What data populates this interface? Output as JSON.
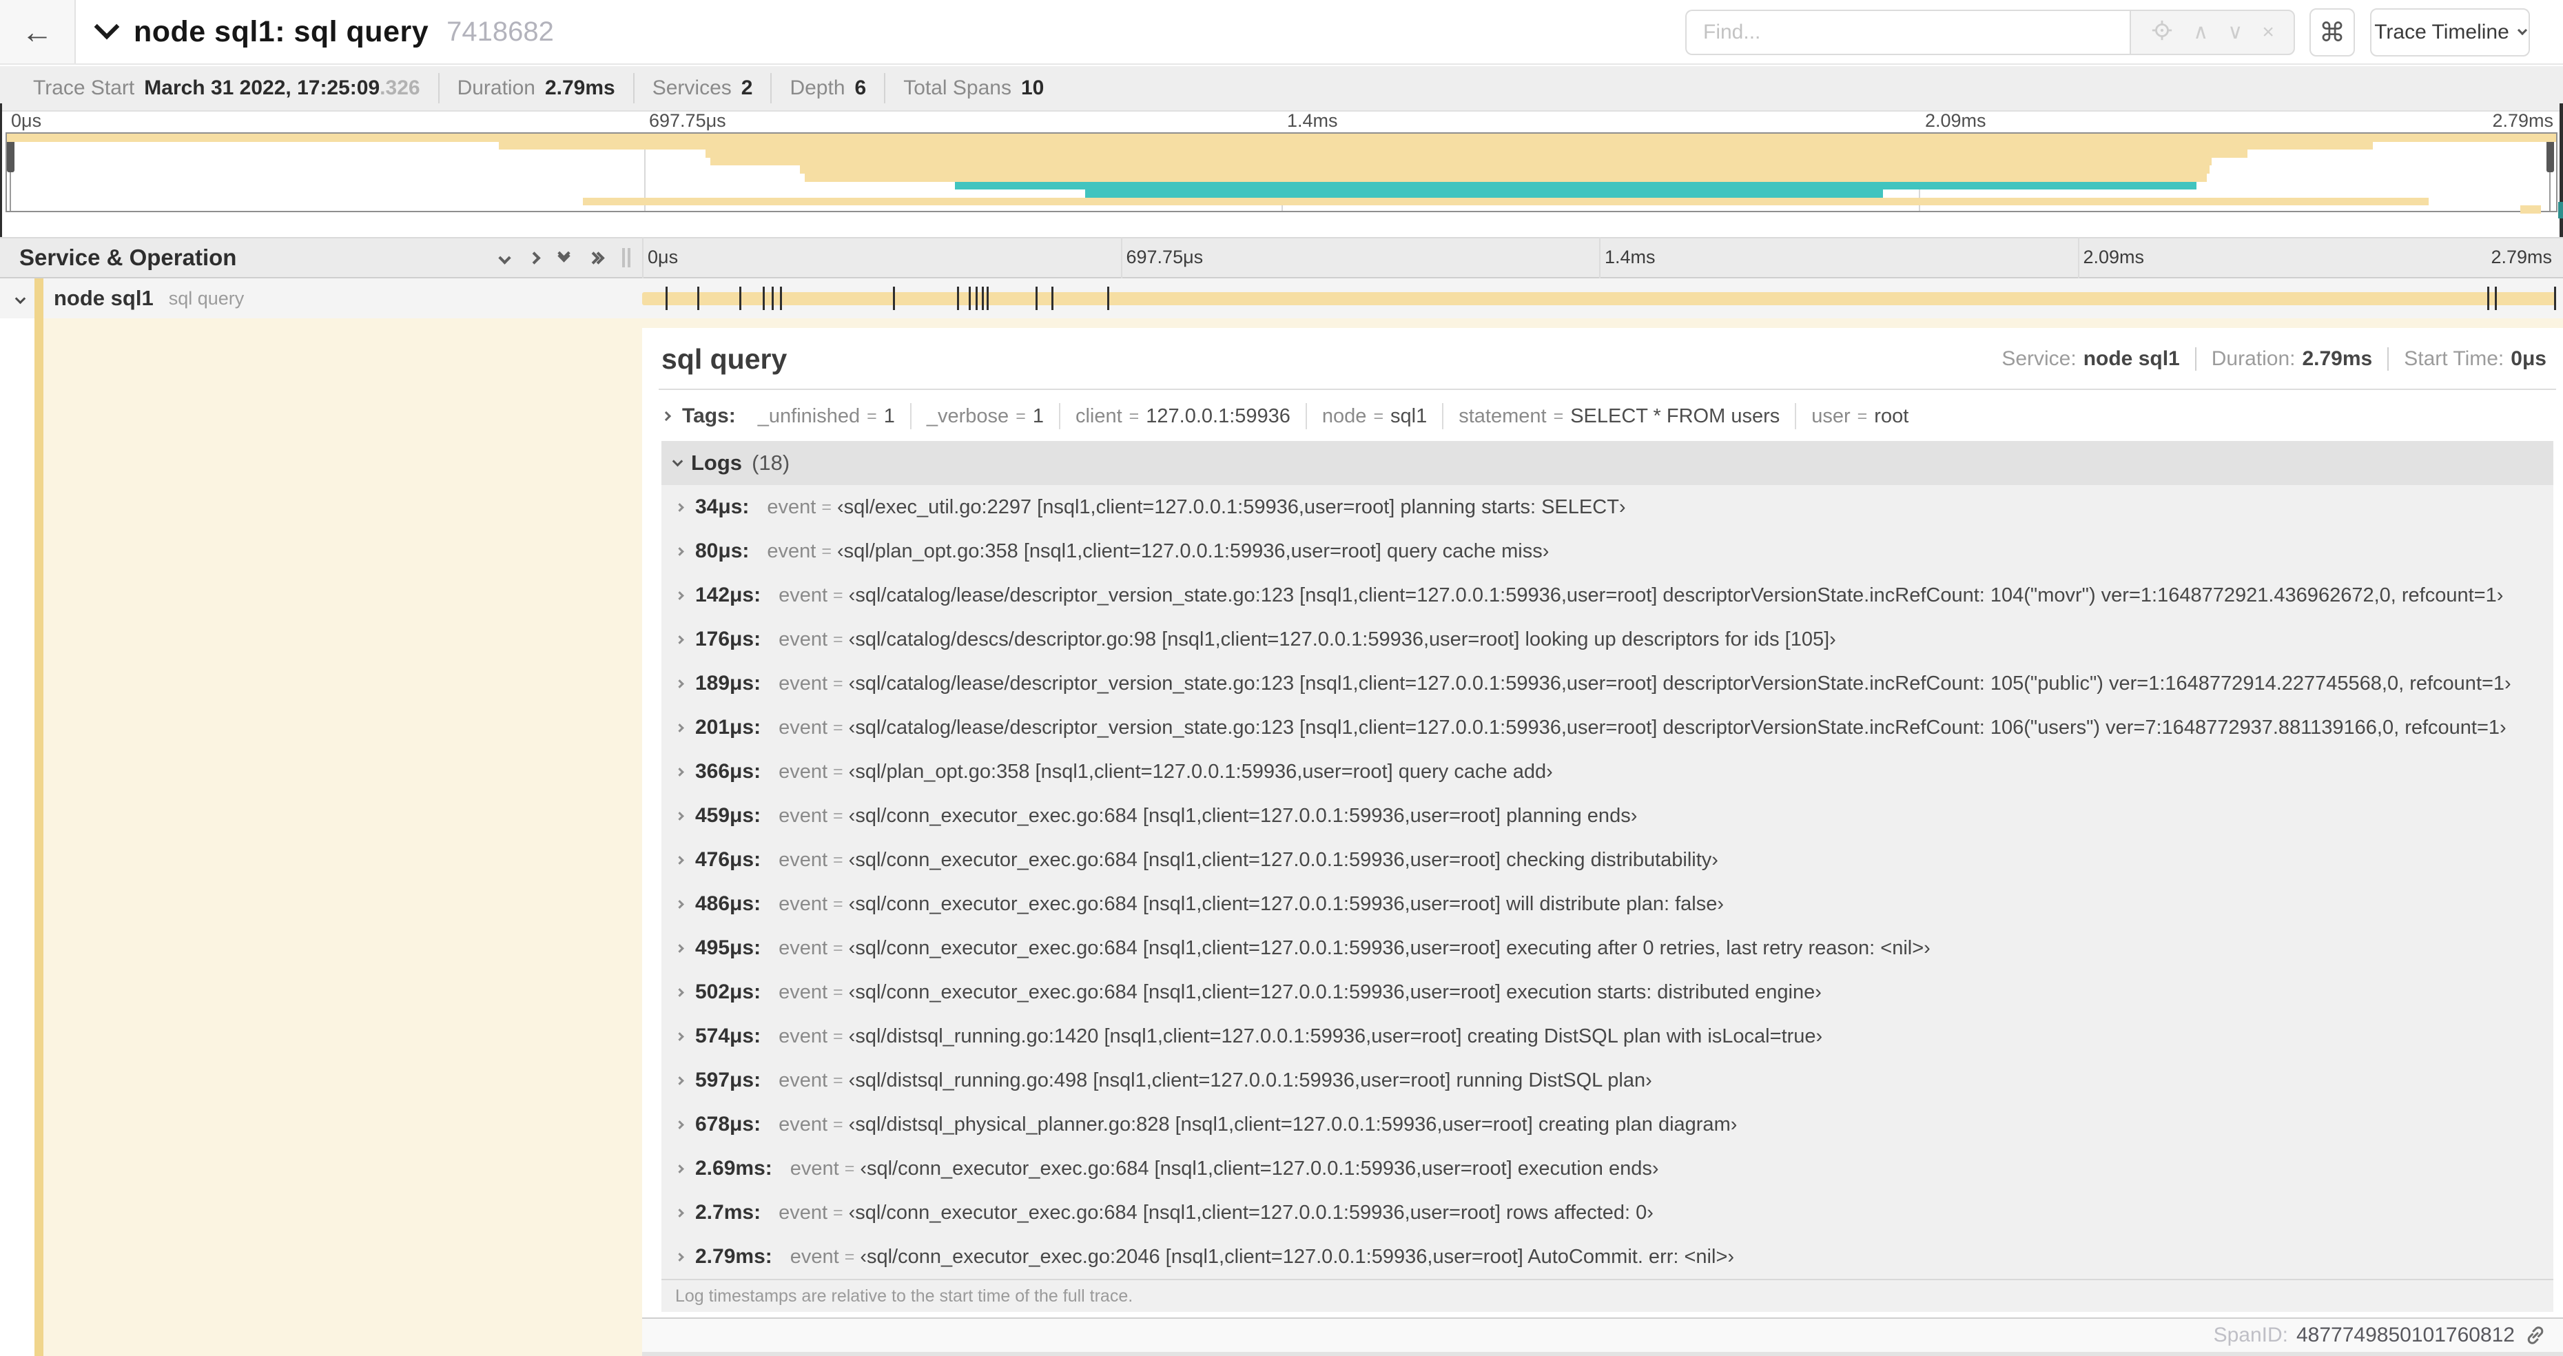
{
  "app": {
    "title": "node sql1: sql query",
    "trace_id": "7418682"
  },
  "icons": {
    "back": "←",
    "command": "⌘",
    "find_prev": "∧",
    "find_next": "∨",
    "find_clear": "×"
  },
  "header": {
    "find_placeholder": "Find...",
    "view_selector_label": "Trace Timeline"
  },
  "summary": {
    "items": [
      {
        "label": "Trace Start",
        "value": "March 31 2022, 17:25:09",
        "suffix": ".326"
      },
      {
        "label": "Duration",
        "value": "2.79ms",
        "suffix": ""
      },
      {
        "label": "Services",
        "value": "2",
        "suffix": ""
      },
      {
        "label": "Depth",
        "value": "6",
        "suffix": ""
      },
      {
        "label": "Total Spans",
        "value": "10",
        "suffix": ""
      }
    ]
  },
  "timeline": {
    "left_header": "Service & Operation",
    "ruler_labels": [
      {
        "label": "0μs",
        "pct": 0
      },
      {
        "label": "697.75μs",
        "pct": 25
      },
      {
        "label": "1.4ms",
        "pct": 50
      },
      {
        "label": "2.09ms",
        "pct": 75
      },
      {
        "label": "2.79ms",
        "pct": 100
      }
    ],
    "minimap_gridlines_pct": [
      25,
      50,
      75
    ],
    "main_gridlines_pct": [
      0,
      25,
      50,
      75
    ],
    "minimap_bars": [
      {
        "row": 0,
        "start": 0,
        "end": 100,
        "color": "tan"
      },
      {
        "row": 1,
        "start": 19.3,
        "end": 92.8,
        "color": "tan"
      },
      {
        "row": 2,
        "start": 27.4,
        "end": 87.9,
        "color": "tan"
      },
      {
        "row": 3,
        "start": 27.6,
        "end": 86.5,
        "color": "tan"
      },
      {
        "row": 4,
        "start": 31.1,
        "end": 86.4,
        "color": "tan"
      },
      {
        "row": 5,
        "start": 31.3,
        "end": 86.3,
        "color": "tan"
      },
      {
        "row": 6,
        "start": 37.2,
        "end": 85.9,
        "color": "teal"
      },
      {
        "row": 7,
        "start": 42.3,
        "end": 73.6,
        "color": "teal"
      },
      {
        "row": 8,
        "start": 22.6,
        "end": 95.0,
        "color": "tan"
      },
      {
        "row": 9,
        "start": 98.6,
        "end": 99.4,
        "color": "tan"
      }
    ]
  },
  "span_row": {
    "service": "node sql1",
    "operation": "sql query",
    "bar_start_pct": 0,
    "bar_end_pct": 100,
    "log_tick_pcts": [
      1.22,
      2.87,
      5.09,
      6.31,
      6.77,
      7.2,
      13.12,
      16.45,
      17.06,
      17.42,
      17.74,
      18.0,
      20.57,
      21.4,
      24.3,
      96.4,
      96.8,
      100
    ]
  },
  "detail": {
    "operation": "sql query",
    "service_label": "Service:",
    "service": "node sql1",
    "duration_label": "Duration:",
    "duration": "2.79ms",
    "start_label": "Start Time:",
    "start_time": "0μs",
    "eq_sign": "=",
    "tags_label": "Tags:",
    "tags": [
      {
        "key": "_unfinished",
        "value": "1"
      },
      {
        "key": "_verbose",
        "value": "1"
      },
      {
        "key": "client",
        "value": "127.0.0.1:59936"
      },
      {
        "key": "node",
        "value": "sql1"
      },
      {
        "key": "statement",
        "value": "SELECT * FROM users"
      },
      {
        "key": "user",
        "value": "root"
      }
    ],
    "logs_label": "Logs",
    "logs_count": "(18)",
    "logs": [
      {
        "time": "34μs:",
        "key": "event",
        "value": "‹sql/exec_util.go:2297 [nsql1,client=127.0.0.1:59936,user=root] planning starts: SELECT›"
      },
      {
        "time": "80μs:",
        "key": "event",
        "value": "‹sql/plan_opt.go:358 [nsql1,client=127.0.0.1:59936,user=root] query cache miss›"
      },
      {
        "time": "142μs:",
        "key": "event",
        "value": "‹sql/catalog/lease/descriptor_version_state.go:123 [nsql1,client=127.0.0.1:59936,user=root] descriptorVersionState.incRefCount: 104(\"movr\") ver=1:1648772921.436962672,0, refcount=1›"
      },
      {
        "time": "176μs:",
        "key": "event",
        "value": "‹sql/catalog/descs/descriptor.go:98 [nsql1,client=127.0.0.1:59936,user=root] looking up descriptors for ids [105]›"
      },
      {
        "time": "189μs:",
        "key": "event",
        "value": "‹sql/catalog/lease/descriptor_version_state.go:123 [nsql1,client=127.0.0.1:59936,user=root] descriptorVersionState.incRefCount: 105(\"public\") ver=1:1648772914.227745568,0, refcount=1›"
      },
      {
        "time": "201μs:",
        "key": "event",
        "value": "‹sql/catalog/lease/descriptor_version_state.go:123 [nsql1,client=127.0.0.1:59936,user=root] descriptorVersionState.incRefCount: 106(\"users\") ver=7:1648772937.881139166,0, refcount=1›"
      },
      {
        "time": "366μs:",
        "key": "event",
        "value": "‹sql/plan_opt.go:358 [nsql1,client=127.0.0.1:59936,user=root] query cache add›"
      },
      {
        "time": "459μs:",
        "key": "event",
        "value": "‹sql/conn_executor_exec.go:684 [nsql1,client=127.0.0.1:59936,user=root] planning ends›"
      },
      {
        "time": "476μs:",
        "key": "event",
        "value": "‹sql/conn_executor_exec.go:684 [nsql1,client=127.0.0.1:59936,user=root] checking distributability›"
      },
      {
        "time": "486μs:",
        "key": "event",
        "value": "‹sql/conn_executor_exec.go:684 [nsql1,client=127.0.0.1:59936,user=root] will distribute plan: false›"
      },
      {
        "time": "495μs:",
        "key": "event",
        "value": "‹sql/conn_executor_exec.go:684 [nsql1,client=127.0.0.1:59936,user=root] executing after 0 retries, last retry reason: <nil>›"
      },
      {
        "time": "502μs:",
        "key": "event",
        "value": "‹sql/conn_executor_exec.go:684 [nsql1,client=127.0.0.1:59936,user=root] execution starts: distributed engine›"
      },
      {
        "time": "574μs:",
        "key": "event",
        "value": "‹sql/distsql_running.go:1420 [nsql1,client=127.0.0.1:59936,user=root] creating DistSQL plan with isLocal=true›"
      },
      {
        "time": "597μs:",
        "key": "event",
        "value": "‹sql/distsql_running.go:498 [nsql1,client=127.0.0.1:59936,user=root] running DistSQL plan›"
      },
      {
        "time": "678μs:",
        "key": "event",
        "value": "‹sql/distsql_physical_planner.go:828 [nsql1,client=127.0.0.1:59936,user=root] creating plan diagram›"
      },
      {
        "time": "2.69ms:",
        "key": "event",
        "value": "‹sql/conn_executor_exec.go:684 [nsql1,client=127.0.0.1:59936,user=root] execution ends›"
      },
      {
        "time": "2.7ms:",
        "key": "event",
        "value": "‹sql/conn_executor_exec.go:684 [nsql1,client=127.0.0.1:59936,user=root] rows affected: 0›"
      },
      {
        "time": "2.79ms:",
        "key": "event",
        "value": "‹sql/conn_executor_exec.go:2046 [nsql1,client=127.0.0.1:59936,user=root] AutoCommit. err: <nil>›"
      }
    ],
    "footer_note": "Log timestamps are relative to the start time of the full trace.",
    "spanid_label": "SpanID:",
    "spanid_value": "4877749850101760812"
  },
  "colors": {
    "tan": "#F6DEA3",
    "tan_accent": "#F0D58C",
    "teal": "#41C4BF",
    "cream": "#FBF4E1"
  }
}
